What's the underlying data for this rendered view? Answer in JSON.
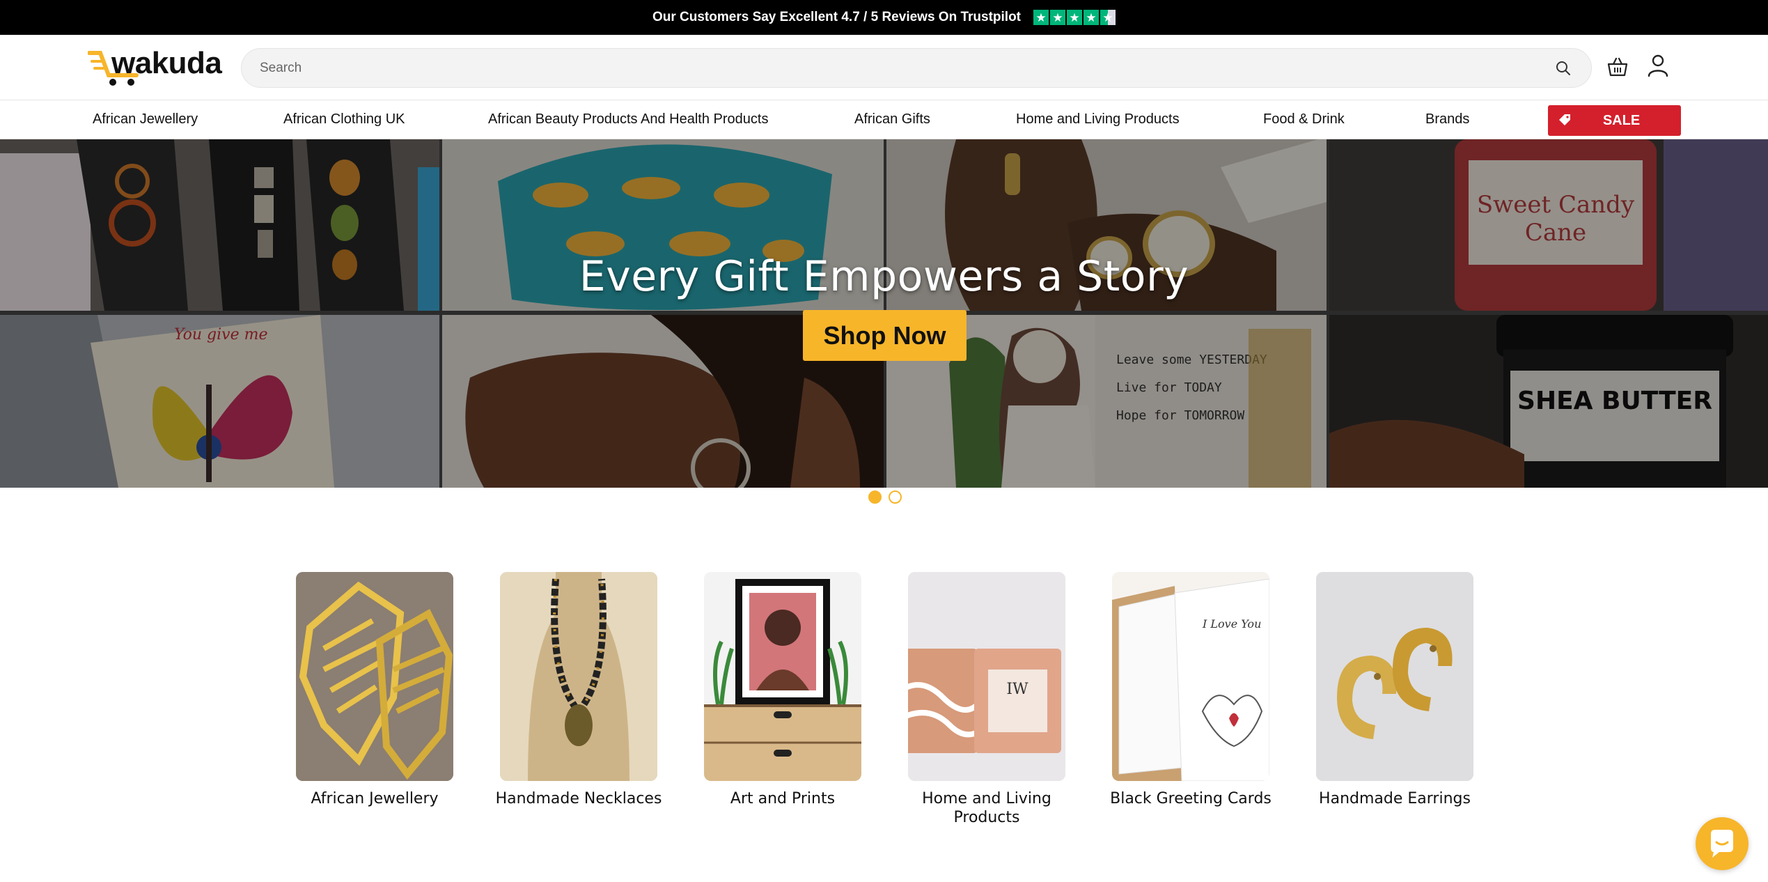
{
  "topbar": {
    "text": "Our Customers Say Excellent 4.7 / 5 Reviews On Trustpilot",
    "rating": 4.5,
    "star_color": "#00b67a"
  },
  "header": {
    "logo_text": "wakuda",
    "search": {
      "placeholder": "Search",
      "value": ""
    },
    "icons": [
      "search-icon",
      "basket-icon",
      "user-icon"
    ]
  },
  "nav": {
    "items": [
      "African Jewellery",
      "African Clothing UK",
      "African Beauty Products And Health Products",
      "African Gifts",
      "Home and Living Products",
      "Food & Drink",
      "Brands"
    ],
    "sale_label": "SALE",
    "sale_color": "#d4202c"
  },
  "hero": {
    "title": "Every Gift Empowers a Story",
    "cta_label": "Shop Now",
    "cta_color": "#f7b52a",
    "slides_total": 2,
    "active_slide": 1,
    "tile_texts": {
      "candle_label": "Sweet Candy Cane",
      "card_text": "You give me",
      "shea_text": "SHEA BUTTER",
      "mirror_text": "Leave some YESTERDAY Live for TODAY Hope for TOMORROW"
    }
  },
  "categories": [
    {
      "label": "African Jewellery",
      "image": "gold-africa-earrings"
    },
    {
      "label": "Handmade Necklaces",
      "image": "beaded-necklace"
    },
    {
      "label": "Art and Prints",
      "image": "framed-portrait-print"
    },
    {
      "label": "Home and Living Products",
      "image": "candle-tins"
    },
    {
      "label": "Black Greeting Cards",
      "image": "greeting-cards"
    },
    {
      "label": "Handmade Earrings",
      "image": "gold-hoop-earrings"
    }
  ],
  "chat": {
    "icon": "chat-bubble-icon",
    "color": "#f7b52a"
  }
}
